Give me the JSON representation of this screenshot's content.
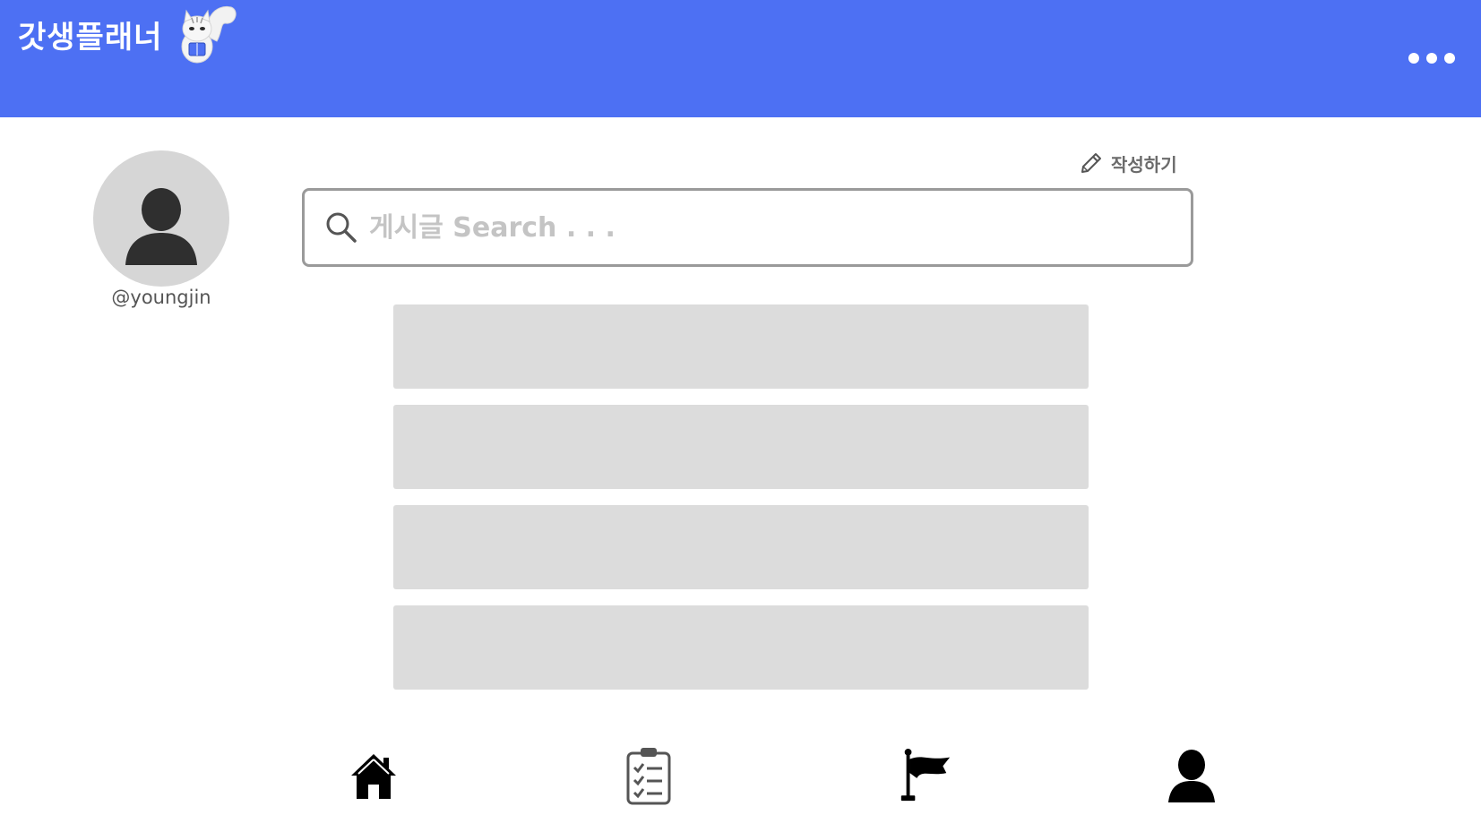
{
  "header": {
    "app_title": "갓생플래너",
    "background_color": "#4d70f3",
    "more_icon": "more-horizontal-icon"
  },
  "profile": {
    "username": "@youngjin",
    "avatar_icon": "user-avatar-icon"
  },
  "write_button": {
    "label": "작성하기",
    "icon": "pencil-icon"
  },
  "search": {
    "placeholder": "게시글 Search . . .",
    "value": "",
    "icon": "search-icon"
  },
  "posts": [
    {
      "title": ""
    },
    {
      "title": ""
    },
    {
      "title": ""
    },
    {
      "title": ""
    }
  ],
  "bottom_nav": {
    "items": [
      {
        "icon": "home-icon"
      },
      {
        "icon": "checklist-icon"
      },
      {
        "icon": "flag-icon"
      },
      {
        "icon": "profile-icon"
      }
    ]
  }
}
